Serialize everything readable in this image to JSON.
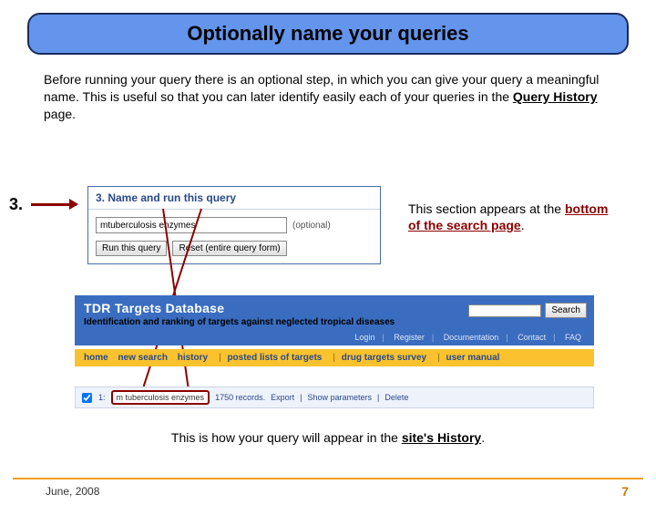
{
  "title": "Optionally name your queries",
  "intro": {
    "pre": "Before running your query there is an optional step, in which you can give your query a meaningful name. This is useful so that you can later identify easily each of your queries in the ",
    "link": "Query History",
    "post": " page."
  },
  "step_number": "3.",
  "query_box": {
    "header": "3. Name and run this query",
    "input_value": "mtuberculosis enzymes",
    "optional": "(optional)",
    "run_btn": "Run this query",
    "reset_btn": "Reset (entire query form)"
  },
  "note_a": {
    "pre": "This section appears at the ",
    "em": "bottom of the search page",
    "post": "."
  },
  "site": {
    "title": "TDR Targets Database",
    "subtitle": "Identification and ranking of targets against neglected tropical diseases",
    "search_btn": "Search",
    "links": [
      "Login",
      "Register",
      "Documentation",
      "Contact",
      "FAQ"
    ],
    "nav": [
      "home",
      "new search",
      "history",
      "posted lists of targets",
      "drug targets survey",
      "user manual"
    ],
    "result": {
      "index": "1:",
      "name": "m tuberculosis enzymes",
      "count": "1750 records.",
      "export": "Export",
      "show": "Show parameters",
      "delete": "Delete"
    }
  },
  "caption": {
    "pre": "This is how your query will appear in the ",
    "em": "site's History",
    "post": "."
  },
  "footer": {
    "date": "June, 2008",
    "page": "7"
  }
}
